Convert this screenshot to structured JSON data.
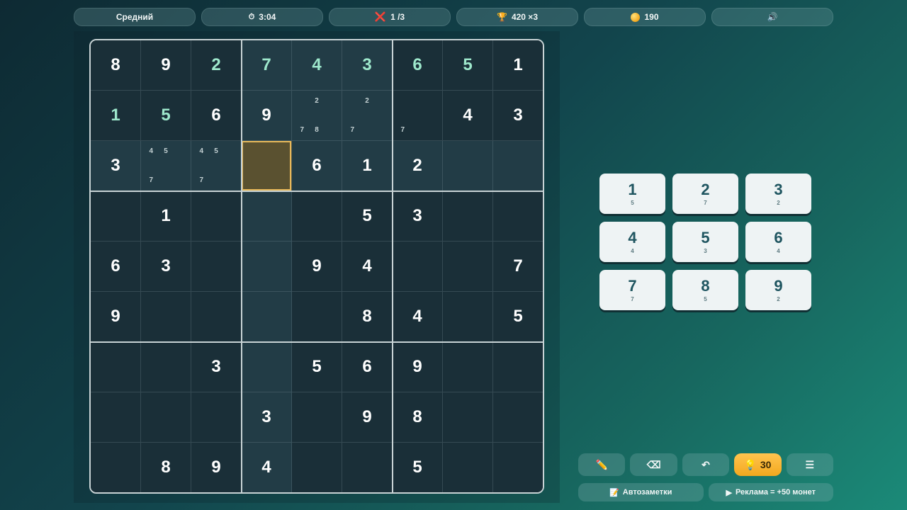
{
  "header": {
    "difficulty": "Средний",
    "timer_icon": "⏱",
    "timer": "3:04",
    "mistakes_icon": "❌",
    "mistakes": "1 /3",
    "score_icon": "🏆",
    "score": "420 ×3",
    "coins": "190",
    "sound_icon": "🔊"
  },
  "board": {
    "cells": [
      [
        "8",
        "9",
        "2",
        "7",
        "4",
        "3",
        "6",
        "5",
        "1"
      ],
      [
        "1",
        "5",
        "6",
        "9",
        "",
        "",
        "",
        "4",
        "3"
      ],
      [
        "3",
        "",
        "",
        "",
        "6",
        "1",
        "2",
        "",
        ""
      ],
      [
        "",
        "1",
        "",
        "",
        "",
        "5",
        "3",
        "",
        ""
      ],
      [
        "6",
        "3",
        "",
        "",
        "9",
        "4",
        "",
        "",
        "7"
      ],
      [
        "9",
        "",
        "",
        "",
        "",
        "8",
        "4",
        "",
        "5"
      ],
      [
        "",
        "",
        "3",
        "",
        "5",
        "6",
        "9",
        "",
        ""
      ],
      [
        "",
        "",
        "",
        "3",
        "",
        "9",
        "8",
        "",
        ""
      ],
      [
        "",
        "8",
        "9",
        "4",
        "",
        "",
        "5",
        "",
        ""
      ]
    ],
    "user_cells": [
      [
        0,
        2
      ],
      [
        0,
        3
      ],
      [
        0,
        4
      ],
      [
        0,
        5
      ],
      [
        0,
        6
      ],
      [
        0,
        7
      ],
      [
        1,
        0
      ],
      [
        1,
        1
      ]
    ],
    "selected": [
      2,
      3
    ],
    "notes": [
      {
        "r": 1,
        "c": 4,
        "slots": [
          "",
          "2",
          "",
          "",
          "",
          "",
          "7",
          "8",
          ""
        ]
      },
      {
        "r": 1,
        "c": 5,
        "slots": [
          "",
          "2",
          "",
          "",
          "",
          "",
          "7",
          "",
          ""
        ]
      },
      {
        "r": 1,
        "c": 6,
        "slots": [
          "",
          "",
          "",
          "",
          "",
          "",
          "7",
          "",
          ""
        ]
      },
      {
        "r": 2,
        "c": 1,
        "slots": [
          "4",
          "5",
          "",
          "",
          "",
          "",
          "7",
          "",
          ""
        ]
      },
      {
        "r": 2,
        "c": 2,
        "slots": [
          "4",
          "5",
          "",
          "",
          "",
          "",
          "7",
          "",
          ""
        ]
      }
    ]
  },
  "numpad": [
    {
      "digit": "1",
      "remaining": "5"
    },
    {
      "digit": "2",
      "remaining": "7"
    },
    {
      "digit": "3",
      "remaining": "2"
    },
    {
      "digit": "4",
      "remaining": "4"
    },
    {
      "digit": "5",
      "remaining": "3"
    },
    {
      "digit": "6",
      "remaining": "4"
    },
    {
      "digit": "7",
      "remaining": "7"
    },
    {
      "digit": "8",
      "remaining": "5"
    },
    {
      "digit": "9",
      "remaining": "2"
    }
  ],
  "tools": {
    "pencil_icon": "✏️",
    "erase_icon": "⌫",
    "undo_icon": "↶",
    "hint_icon": "💡",
    "hint_count": "30",
    "menu_icon": "☰"
  },
  "bottom": {
    "autonotes_icon": "📝",
    "autonotes_label": "Автозаметки",
    "ad_icon": "▶",
    "ad_label": "Реклама = +50 монет"
  },
  "colors": {
    "selected_border": "#e7b85a",
    "user_digit": "#9ee8cc",
    "hint_button": "#f3a81e"
  }
}
